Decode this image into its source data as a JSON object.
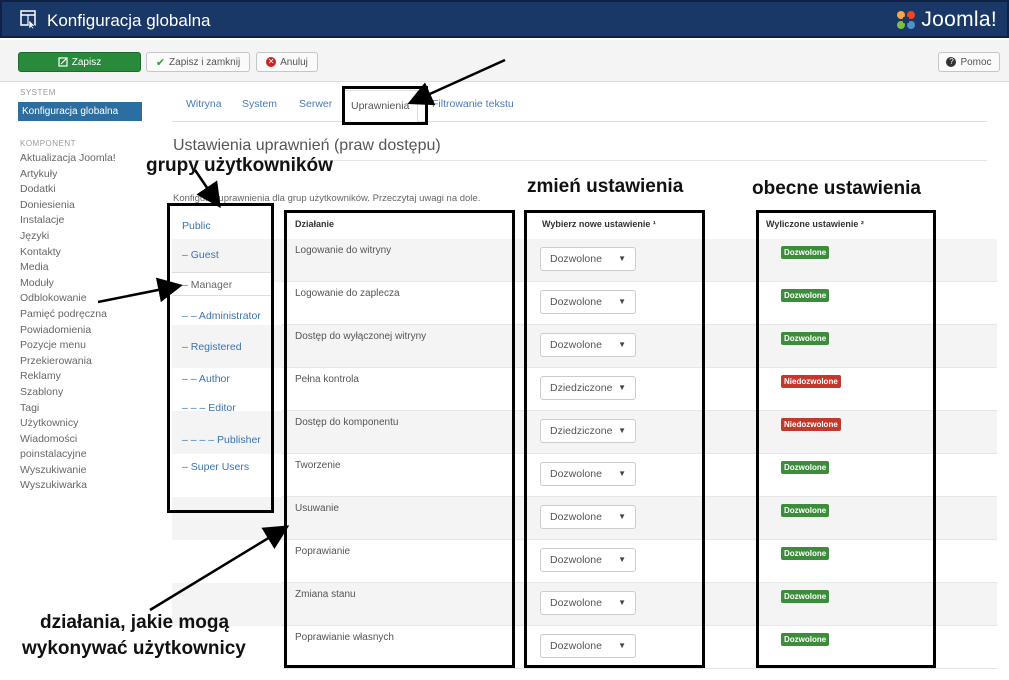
{
  "header": {
    "title": "Konfiguracja globalna",
    "logo_text": "Joomla!"
  },
  "toolbar": {
    "save": "Zapisz",
    "save_close": "Zapisz i zamknij",
    "cancel": "Anuluj",
    "help": "Pomoc"
  },
  "sidebar": {
    "system_heading": "SYSTEM",
    "active_item": "Konfiguracja globalna",
    "components_heading": "KOMPONENT",
    "items": [
      "Aktualizacja Joomla!",
      "Artykuły",
      "Dodatki",
      "Doniesienia",
      "Instalacje",
      "Języki",
      "Kontakty",
      "Media",
      "Moduły",
      "Odblokowanie",
      "Pamięć podręczna",
      "Powiadomienia",
      "Pozycje menu",
      "Przekierowania",
      "Reklamy",
      "Szablony",
      "Tagi",
      "Użytkownicy",
      "Wiadomości",
      "poinstalacyjne",
      "Wyszukiwanie",
      "Wyszukiwarka"
    ]
  },
  "tabs": [
    "Witryna",
    "System",
    "Serwer",
    "Uprawnienia",
    "Filtrowanie tekstu"
  ],
  "active_tab_index": 3,
  "main": {
    "heading": "Ustawienia uprawnień (praw dostępu)",
    "description": "Konfiguruj uprawnienia dla grup użytkowników. Przeczytaj uwagi na dole.",
    "col_action": "Działanie",
    "col_new": "Wybierz nowe ustawienie ¹",
    "col_current": "Wyliczone ustawienie ²"
  },
  "groups": [
    "Public",
    "– Guest",
    "– Manager",
    "– – Administrator",
    "– Registered",
    "– – Author",
    "– – – Editor",
    "– – – – Publisher",
    "– Super Users"
  ],
  "active_group_index": 2,
  "rows": [
    {
      "action": "Logowanie do witryny",
      "select": "Dozwolone",
      "status": "Dozwolone",
      "status_type": "allowed"
    },
    {
      "action": "Logowanie do zaplecza",
      "select": "Dozwolone",
      "status": "Dozwolone",
      "status_type": "allowed"
    },
    {
      "action": "Dostęp do wyłączonej witryny",
      "select": "Dozwolone",
      "status": "Dozwolone",
      "status_type": "allowed"
    },
    {
      "action": "Pełna kontrola",
      "select": "Dziedziczone",
      "status": "Niedozwolone",
      "status_type": "denied"
    },
    {
      "action": "Dostęp do komponentu",
      "select": "Dziedziczone",
      "status": "Niedozwolone",
      "status_type": "denied"
    },
    {
      "action": "Tworzenie",
      "select": "Dozwolone",
      "status": "Dozwolone",
      "status_type": "allowed"
    },
    {
      "action": "Usuwanie",
      "select": "Dozwolone",
      "status": "Dozwolone",
      "status_type": "allowed"
    },
    {
      "action": "Poprawianie",
      "select": "Dozwolone",
      "status": "Dozwolone",
      "status_type": "allowed"
    },
    {
      "action": "Zmiana stanu",
      "select": "Dozwolone",
      "status": "Dozwolone",
      "status_type": "allowed"
    },
    {
      "action": "Poprawianie własnych",
      "select": "Dozwolone",
      "status": "Dozwolone",
      "status_type": "allowed"
    }
  ],
  "annotations": {
    "groups": "grupy użytkowników",
    "change": "zmień ustawienia",
    "current": "obecne ustawienia",
    "actions_line1": "działania, jakie mogą",
    "actions_line2": "wykonywać użytkownicy"
  },
  "colors": {
    "header_bg": "#1a3867",
    "save_green": "#2a8a3c",
    "allowed": "#3c8c3c",
    "denied": "#c0392b",
    "link": "#3a74b0",
    "active_sidebar": "#2d6ea0"
  },
  "icons": {
    "app": "window-icon",
    "logo": "joomla-logo-icon",
    "save": "edit-icon",
    "save_close": "check-icon",
    "cancel": "times-circle-icon",
    "help": "question-circle-icon"
  }
}
